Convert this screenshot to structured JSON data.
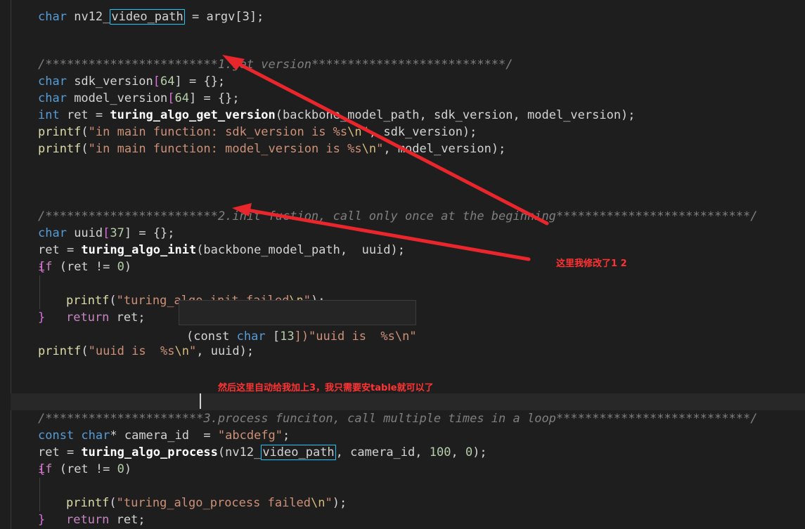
{
  "code": {
    "line0": {
      "a": "char",
      "b": " ",
      "c": "nv12_",
      "d": "video_path",
      "e": " = argv[3];"
    },
    "comment1": {
      "stars": "/************************",
      "text": "1.get version",
      "tail": "***************************/"
    },
    "sdk": {
      "type": "char",
      "name": " sdk_version",
      "open": "[",
      "num": "64",
      "rest": "] = {};"
    },
    "model": {
      "type": "char",
      "name": " model_version",
      "open": "[",
      "num": "64",
      "rest": "] = {};"
    },
    "ret1": {
      "type": "int",
      "a": " ret = ",
      "fn": "turing_algo_get_version",
      "args": "(backbone_model_path, sdk_version, model_version);"
    },
    "printf1": {
      "fn": "printf",
      "open": "(",
      "str": "\"in main function: sdk_version is %s",
      "esc": "\\n",
      "close": "\"",
      "rest": ", sdk_version);"
    },
    "printf2": {
      "fn": "printf",
      "open": "(",
      "str": "\"in main function: model_version is %s",
      "esc": "\\n",
      "close": "\"",
      "rest": ", model_version);"
    },
    "comment2": {
      "stars": "/************************",
      "text": "2.init fuction, call only once at the beginning",
      "tail": "***************************/"
    },
    "uuid": {
      "type": "char",
      "name": " uuid",
      "open": "[",
      "num": "37",
      "rest": "] = {};"
    },
    "ret2": {
      "a": "ret = ",
      "fn": "turing_algo_init",
      "args": "(backbone_model_path,  uuid);"
    },
    "if1": {
      "kw": "if",
      "a": " (ret != ",
      "num": "0",
      "b": ")"
    },
    "brace_open1": "{",
    "printf3": {
      "fn": "printf",
      "open": "(",
      "str": "\"turing_algo_init failed",
      "esc": "\\n",
      "close": "\"",
      "rest": ");"
    },
    "return1": {
      "kw": "return",
      "rest": " ret;"
    },
    "brace_close1": "}",
    "printf4": {
      "fn": "printf",
      "open": "(",
      "str": "\"uuid is  %s",
      "esc": "\\n",
      "close": "\"",
      "rest": ", uuid);"
    },
    "comment3": {
      "stars": "/**********************",
      "text": "3.process funciton, call multiple times in a loop",
      "tail": "***************************/"
    },
    "camera": {
      "kw": "const",
      "t": " char",
      "a": "* camera_id  = ",
      "str": "\"abcdefg\"",
      "rest": ";"
    },
    "ret3": {
      "a": "ret = ",
      "fn": "turing_algo_process",
      "open": "(nv12_",
      "box": "video_path",
      "rest": ", camera_id, ",
      "n1": "100",
      "sep": ", ",
      "n2": "0",
      "end": ");"
    },
    "if2": {
      "kw": "if",
      "a": " (ret != ",
      "num": "0",
      "b": ")"
    },
    "brace_open2": "{",
    "printf5": {
      "fn": "printf",
      "open": "(",
      "str": "\"turing_algo_process failed",
      "esc": "\\n",
      "close": "\"",
      "rest": ");"
    },
    "return2": {
      "kw": "return",
      "rest": " ret;"
    },
    "brace_close2": "}"
  },
  "hover": {
    "a": "(const ",
    "b": "char",
    "c": " [",
    "num": "13",
    "d": "])\"uuid is  %s\\n\""
  },
  "annotations": {
    "note1": "这里我修改了1 2",
    "note2": "然后这里自动给我加上3，我只需要安table就可以了"
  },
  "colors": {
    "arrow": "#e8262b",
    "highlight_box": "#1ec8ff"
  }
}
